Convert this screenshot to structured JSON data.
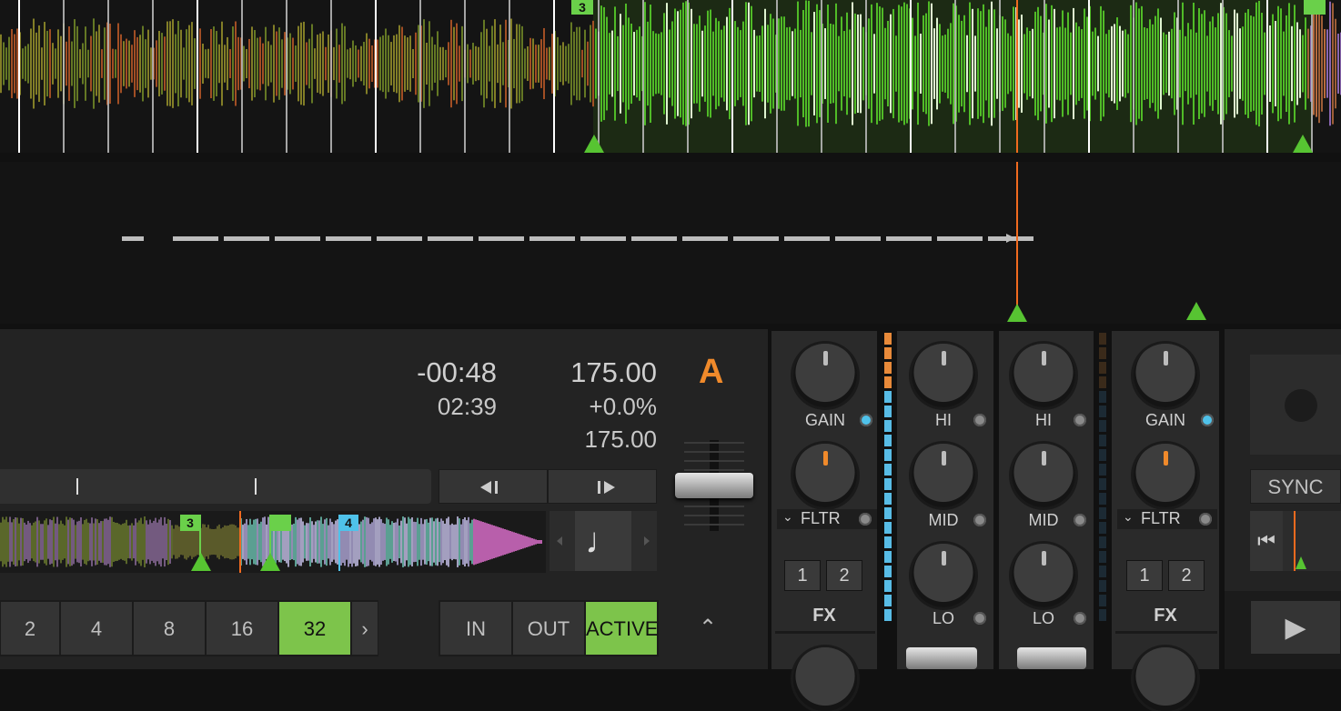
{
  "top_waveform": {
    "cue_label": "3",
    "beat_lines": 30
  },
  "deck": {
    "remaining_time": "-00:48",
    "elapsed_time": "02:39",
    "bpm": "175.00",
    "tempo_percent": "+0.0%",
    "original_bpm": "175.00",
    "deck_letter": "A",
    "beatjump_back_icon": "step-back-icon",
    "beatjump_fwd_icon": "step-forward-icon",
    "overview_cue_3": "3",
    "overview_cue_4": "4",
    "note_icon": "quarter-note-icon",
    "loop_sizes": [
      "2",
      "4",
      "8",
      "16",
      "32"
    ],
    "loop_selected": "32",
    "loop_more": "›",
    "loop_in": "IN",
    "loop_out": "OUT",
    "loop_active": "ACTIVE",
    "collapse": "⌃"
  },
  "mixer": {
    "left_fx": {
      "gain": "GAIN",
      "filter": "FLTR",
      "fx1": "1",
      "fx2": "2",
      "fx": "FX"
    },
    "eq_a": {
      "hi": "HI",
      "mid": "MID",
      "lo": "LO"
    },
    "eq_b": {
      "hi": "HI",
      "mid": "MID",
      "lo": "LO"
    },
    "right_fx": {
      "gain": "GAIN",
      "filter": "FLTR",
      "fx1": "1",
      "fx2": "2",
      "fx": "FX"
    },
    "filter_chevron": "⌄"
  },
  "right_deck": {
    "sync": "SYNC",
    "play": "▶",
    "cue_start": "⏮"
  },
  "colors": {
    "accent_green": "#7dc44b",
    "playhead": "#f06a1f",
    "deck_letter": "#f08a2b",
    "cue_blue": "#4fc2ea"
  }
}
